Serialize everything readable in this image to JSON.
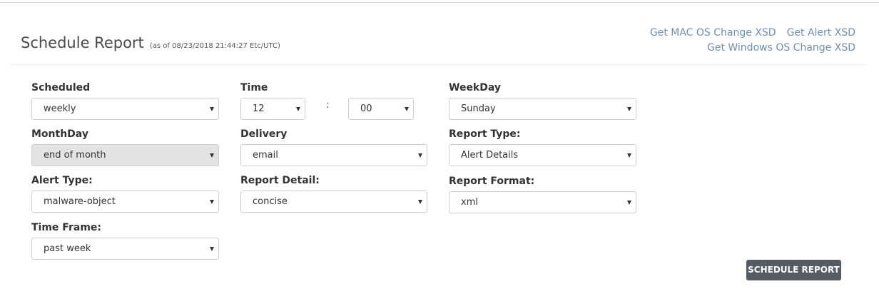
{
  "header": {
    "title": "Schedule Report",
    "as_of": "(as of 08/23/2018 21:44:27 Etc/UTC)",
    "links": {
      "mac_xsd": "Get MAC OS Change XSD",
      "alert_xsd": "Get Alert XSD",
      "windows_xsd": "Get Windows OS Change XSD"
    }
  },
  "form": {
    "scheduled": {
      "label": "Scheduled",
      "value": "weekly"
    },
    "time": {
      "label": "Time",
      "hour": "12",
      "separator": ":",
      "minute": "00"
    },
    "weekday": {
      "label": "WeekDay",
      "value": "Sunday"
    },
    "monthday": {
      "label": "MonthDay",
      "value": "end of month",
      "disabled": true
    },
    "delivery": {
      "label": "Delivery",
      "value": "email"
    },
    "report_type": {
      "label": "Report Type:",
      "value": "Alert Details"
    },
    "alert_type": {
      "label": "Alert Type:",
      "value": "malware-object"
    },
    "report_detail": {
      "label": "Report Detail:",
      "value": "concise"
    },
    "report_format": {
      "label": "Report Format:",
      "value": "xml"
    },
    "time_frame": {
      "label": "Time Frame:",
      "value": "past week"
    }
  },
  "actions": {
    "schedule_button": "SCHEDULE REPORT"
  },
  "colors": {
    "link": "#6f8fb3",
    "button": "#545b63",
    "disabled_field": "#e3e3e3"
  }
}
